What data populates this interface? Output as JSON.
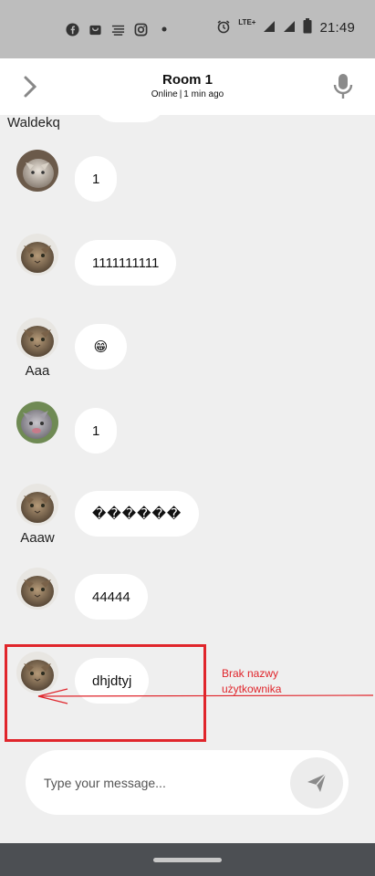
{
  "status_bar": {
    "time": "21:49",
    "network": "LTE+",
    "notification_icons": [
      "facebook-icon",
      "shopping-bag-icon",
      "notes-icon",
      "instagram-icon",
      "dot-icon"
    ],
    "right_icons": [
      "alarm-icon",
      "signal-icon",
      "signal-icon",
      "battery-icon"
    ]
  },
  "header": {
    "title": "Room 1",
    "status": "Online",
    "separator": "|",
    "last_seen": "1 min ago"
  },
  "chat": {
    "top_username": "Waldekq",
    "messages": [
      {
        "text": "1",
        "username": ""
      },
      {
        "text": "1111111111",
        "username": ""
      },
      {
        "text": "😁",
        "username": "Aaa"
      },
      {
        "text": "1",
        "username": ""
      },
      {
        "text": "������",
        "username": "Aaaw"
      },
      {
        "text": "44444",
        "username": ""
      },
      {
        "text": "dhjdtyj",
        "username": ""
      }
    ]
  },
  "annotation": {
    "line1": "Brak nazwy",
    "line2": "użytkownika",
    "color": "#e0252b"
  },
  "composer": {
    "placeholder": "Type your message..."
  },
  "colors": {
    "background": "#efefef",
    "status_bar": "#bdbdbd",
    "nav_bar": "#4c4f53"
  }
}
